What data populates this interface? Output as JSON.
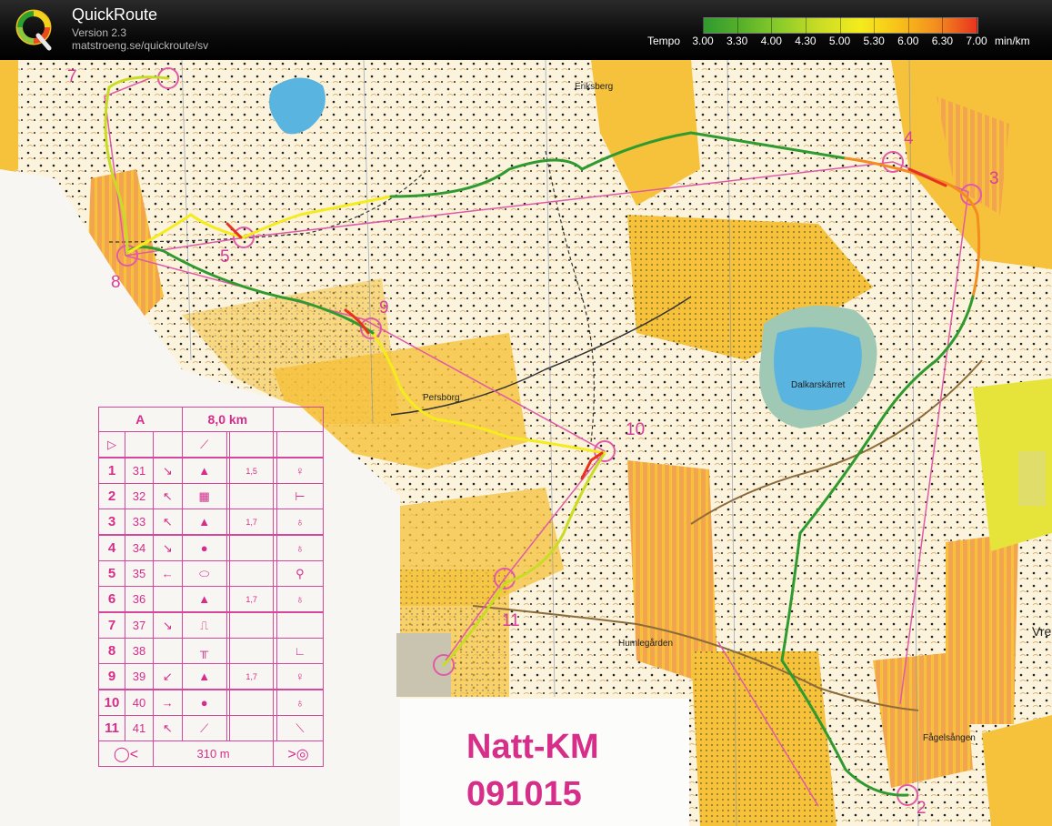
{
  "header": {
    "app_name": "QuickRoute",
    "version": "Version 2.3",
    "url": "matstroeng.se/quickroute/sv",
    "logo_letter": "Q"
  },
  "tempo_scale": {
    "label": "Tempo",
    "unit": "min/km",
    "ticks": [
      "3.00",
      "3.30",
      "4.00",
      "4.30",
      "5.00",
      "5.30",
      "6.00",
      "6.30",
      "7.00"
    ],
    "colors": [
      "#2f9a2f",
      "#8ccc2a",
      "#f4ec1c",
      "#f38d1f",
      "#e8321e"
    ]
  },
  "map": {
    "place_names": {
      "eriksberg": "Eriksberg",
      "persborg": "Persborg",
      "dalkarskarret": "Dalkarskärret",
      "humlegarden": "Humlegården",
      "fagelsangen": "Fågelsången",
      "vre": "Vre"
    },
    "control_numbers": [
      "2",
      "3",
      "4",
      "5",
      "7",
      "8",
      "9",
      "10",
      "11"
    ],
    "colors": {
      "open_land": "#f6c23b",
      "forest": "#fdfbf4",
      "lake": "#5ab4e0",
      "course": "#e05aa8",
      "route_fast": "#2f9a2f",
      "route_mid": "#f4ec1c",
      "route_slow": "#e8321e"
    }
  },
  "description_table": {
    "class_name": "A",
    "course_length": "8,0 km",
    "start_symbol": "▷",
    "rows": [
      {
        "num": "1",
        "code": "31",
        "dir": "↘",
        "feature": "▲",
        "dist": "1,5",
        "loc": "♀"
      },
      {
        "num": "2",
        "code": "32",
        "dir": "↖",
        "feature": "▦",
        "dist": "",
        "loc": "⊢"
      },
      {
        "num": "3",
        "code": "33",
        "dir": "↖",
        "feature": "▲",
        "dist": "1,7",
        "loc": "♁"
      },
      {
        "num": "4",
        "code": "34",
        "dir": "↘",
        "feature": "●",
        "dist": "",
        "loc": "♁"
      },
      {
        "num": "5",
        "code": "35",
        "dir": "←",
        "feature": "⬭",
        "dist": "",
        "loc": "⚲"
      },
      {
        "num": "6",
        "code": "36",
        "dir": "",
        "feature": "▲",
        "dist": "1,7",
        "loc": "♁"
      },
      {
        "num": "7",
        "code": "37",
        "dir": "↘",
        "feature": "⎍",
        "dist": "",
        "loc": ""
      },
      {
        "num": "8",
        "code": "38",
        "dir": "",
        "feature": "╥",
        "dist": "",
        "loc": "∟"
      },
      {
        "num": "9",
        "code": "39",
        "dir": "↙",
        "feature": "▲",
        "dist": "1,7",
        "loc": "♀"
      },
      {
        "num": "10",
        "code": "40",
        "dir": "→",
        "feature": "●",
        "dist": "",
        "loc": "♁"
      },
      {
        "num": "11",
        "code": "41",
        "dir": "↖",
        "feature": "⟋",
        "dist": "",
        "loc": "⟍"
      }
    ],
    "finish_distance": "310 m"
  },
  "event": {
    "title": "Natt-KM",
    "date": "091015"
  }
}
